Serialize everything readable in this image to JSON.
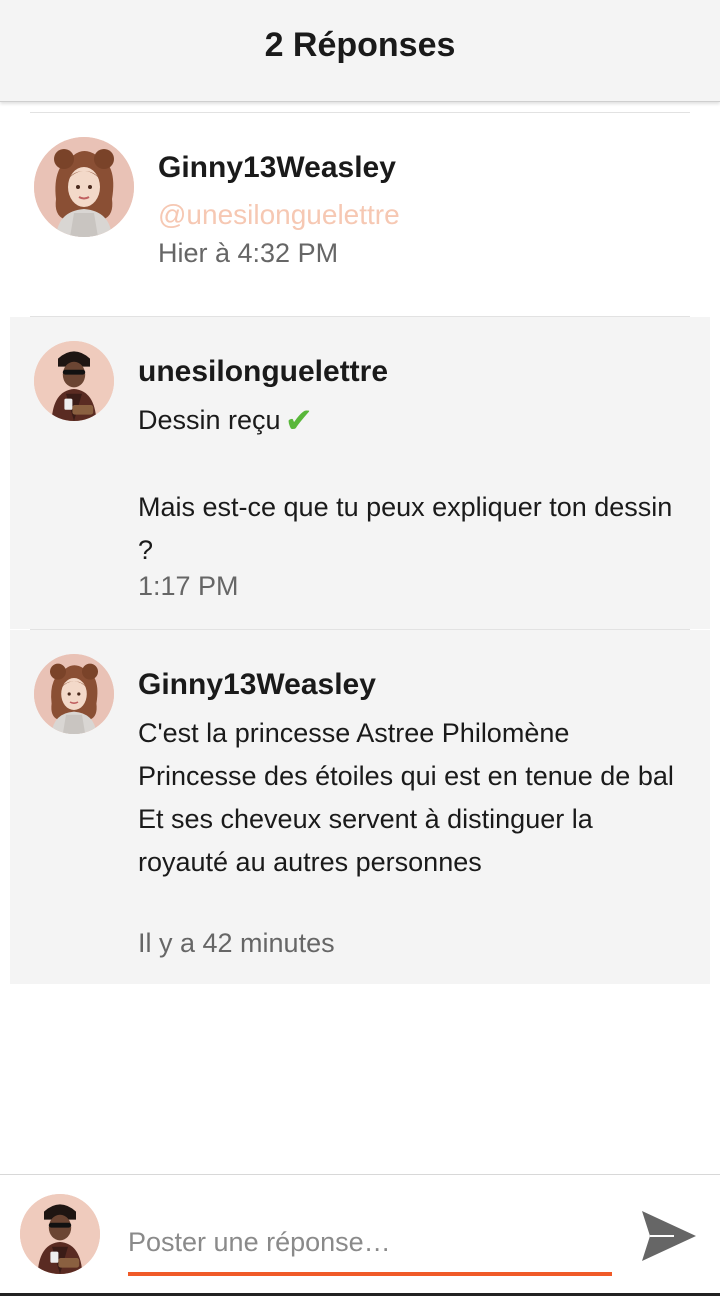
{
  "header": {
    "title": "2 Réponses"
  },
  "original_post": {
    "author": "Ginny13Weasley",
    "mention": "@unesilonguelettre",
    "timestamp": "Hier à 4:32 PM"
  },
  "replies": [
    {
      "author": "unesilonguelettre",
      "lines": [
        "Dessin reçu",
        "",
        "Mais est-ce que tu peux expliquer ton dessin ?"
      ],
      "emoji": "✔",
      "timestamp": "1:17 PM"
    },
    {
      "author": "Ginny13Weasley",
      "lines": [
        "C'est la princesse Astree Philomène",
        "Princesse des étoiles qui est en tenue de bal",
        "Et ses cheveux servent à distinguer la royauté au autres personnes"
      ],
      "timestamp": "Il y a 42 minutes"
    }
  ],
  "compose": {
    "placeholder": "Poster une réponse…"
  },
  "colors": {
    "accent": "#f05a28",
    "mention": "#f6c8b3",
    "check": "#59b73a",
    "reply_bg": "#f4f4f4"
  },
  "icons": {
    "send": "send-icon",
    "check": "check-mark-icon"
  }
}
